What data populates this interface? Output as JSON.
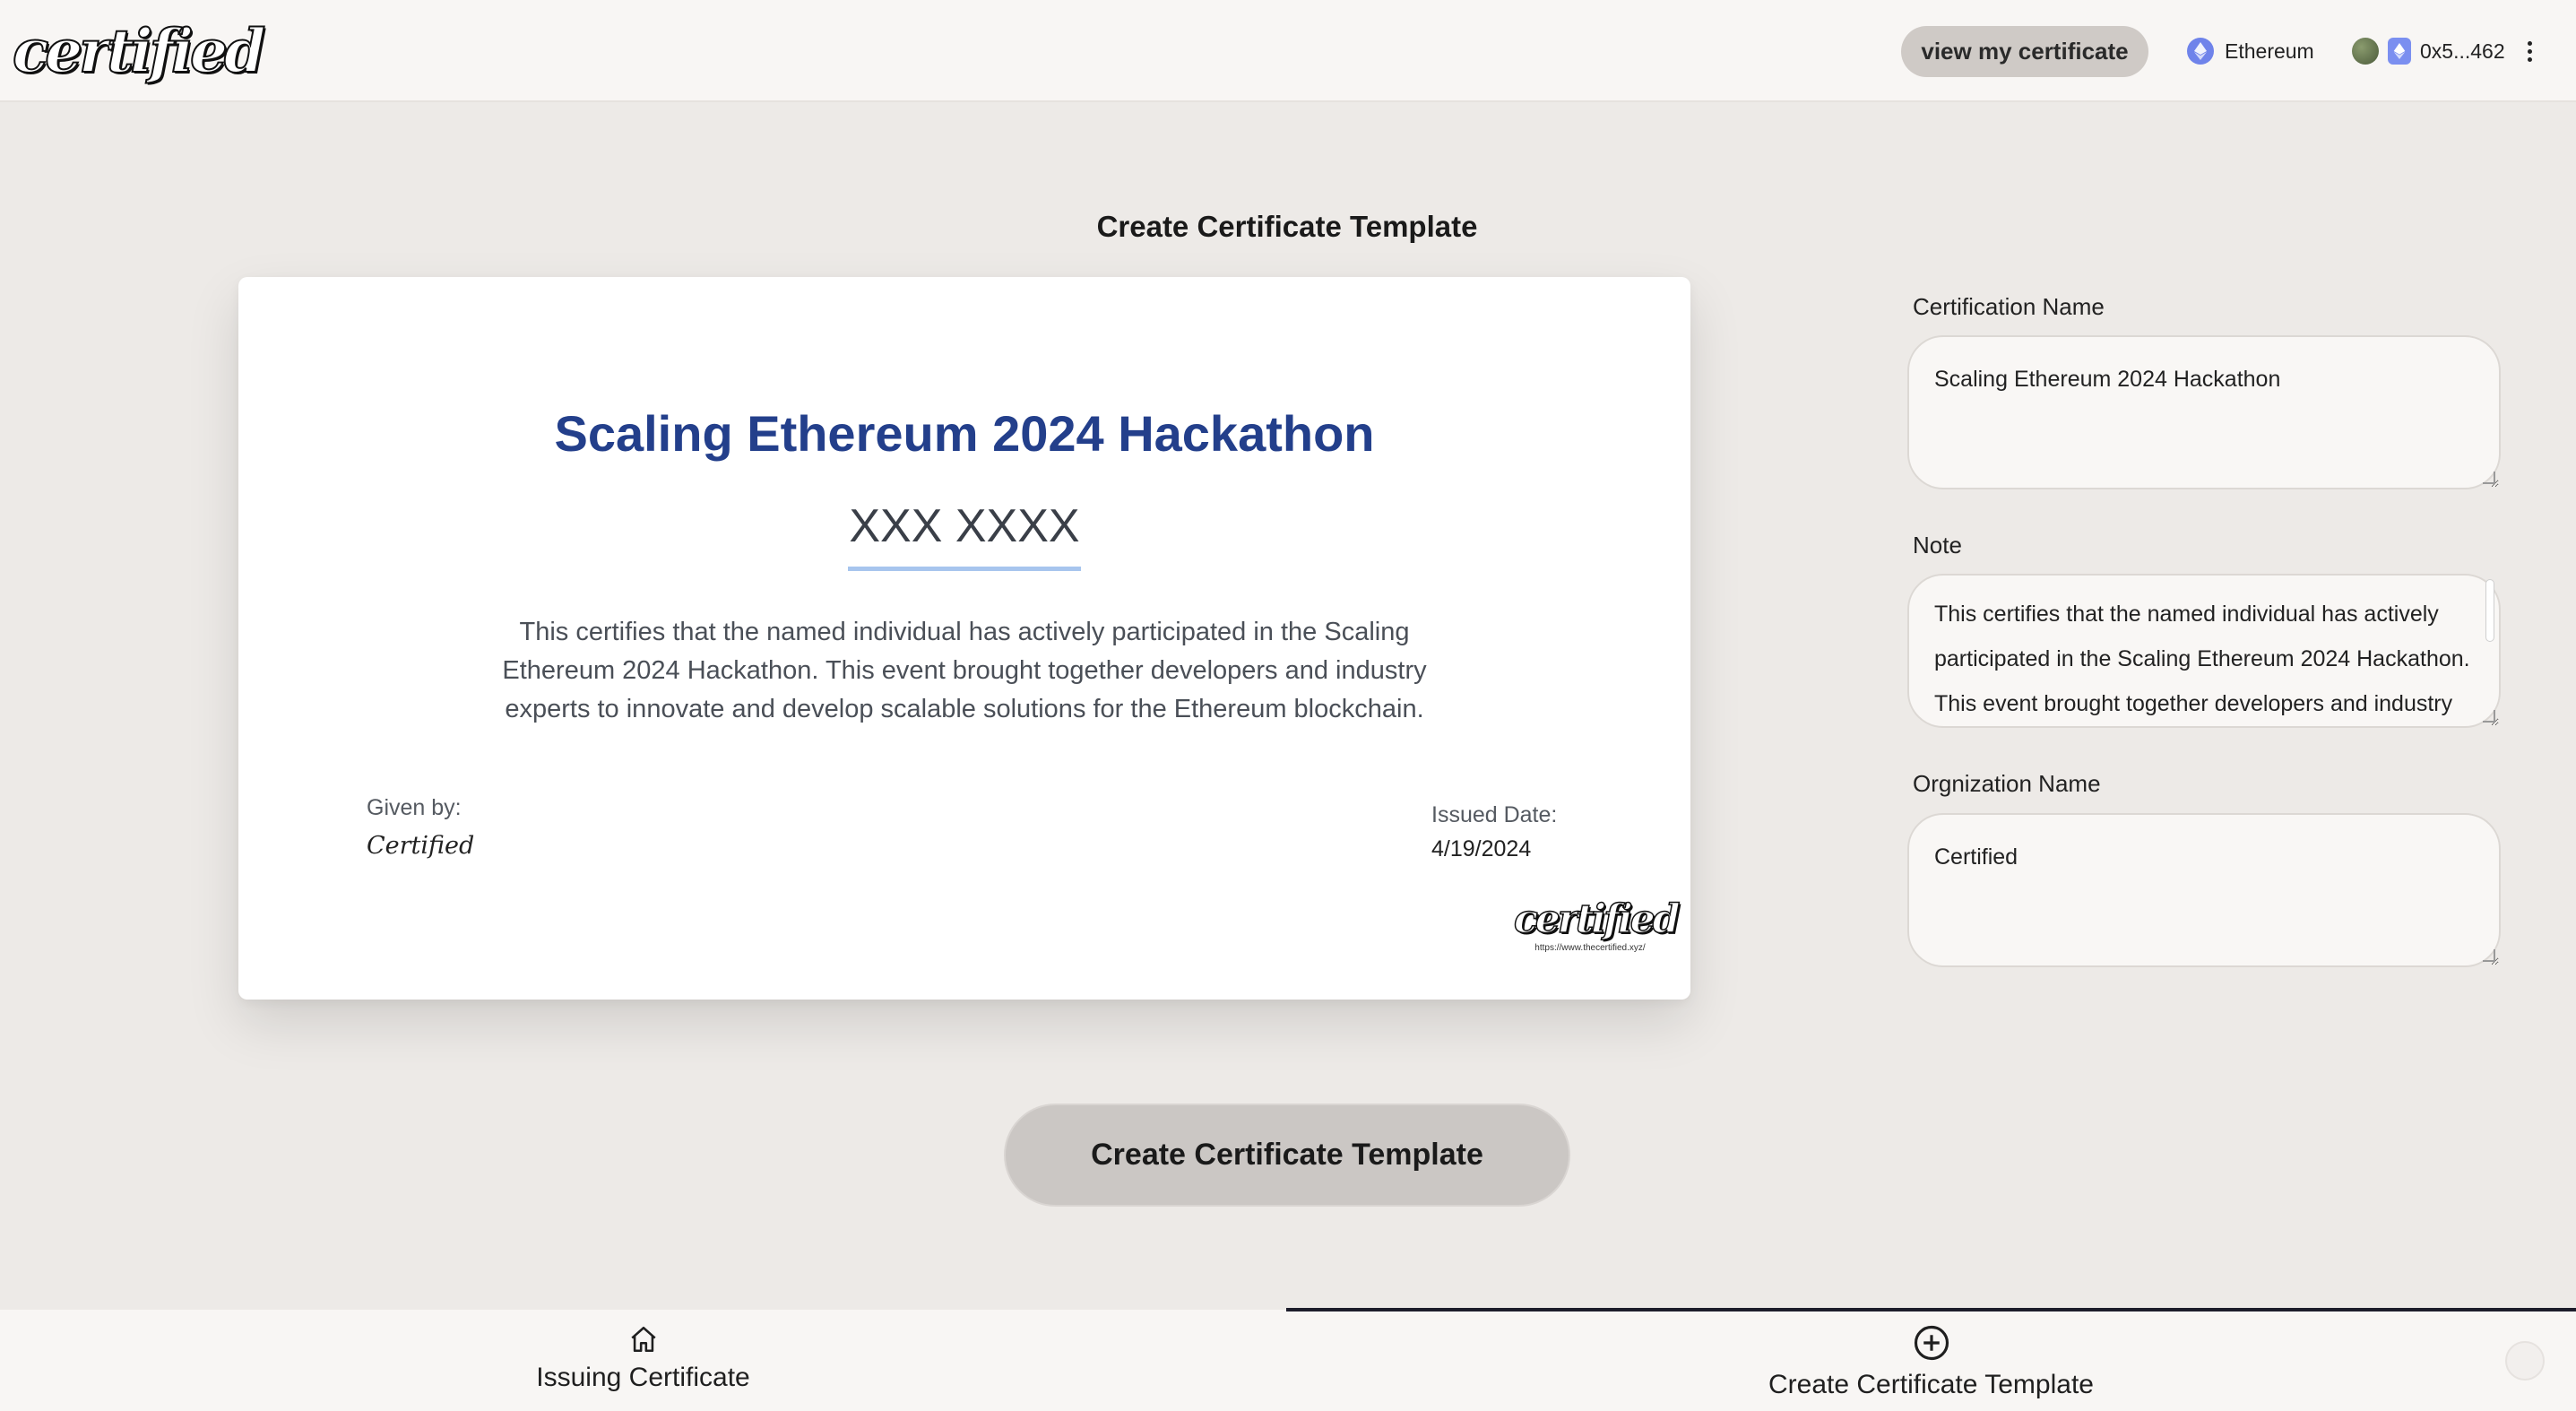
{
  "header": {
    "logo": "certified",
    "view_certificate_label": "view my certificate",
    "network": "Ethereum",
    "account": "0x5...462",
    "network_icon": "ethereum-icon",
    "menu_icon": "kebab-menu-icon"
  },
  "main": {
    "title": "Create Certificate Template",
    "certificate": {
      "name": "Scaling Ethereum 2024 Hackathon",
      "recipient": "XXX XXXX",
      "note": "This certifies that the named individual has actively participated in the Scaling Ethereum 2024 Hackathon. This event brought together developers and industry experts to innovate and develop scalable solutions for the Ethereum blockchain.",
      "given_by_label": "Given by:",
      "given_by": "Certified",
      "issued_date_label": "Issued Date:",
      "issued_date": "4/19/2024",
      "brand": "certified",
      "brand_url": "https://www.thecertified.xyz/"
    },
    "create_button_label": "Create Certificate Template"
  },
  "form": {
    "certification_name_label": "Certification Name",
    "certification_name_value": "Scaling Ethereum 2024 Hackathon",
    "note_label": "Note",
    "note_value": "This certifies that the named individual has actively participated in the Scaling Ethereum 2024 Hackathon. This event brought together developers and industry experts to innovate and develop scalable solutions for the Ethereum blockchain.",
    "organization_label": "Orgnization Name",
    "organization_value": "Certified"
  },
  "bottom_nav": {
    "items": [
      {
        "label": "Issuing Certificate",
        "icon": "home-icon",
        "active": false
      },
      {
        "label": "Create Certificate Template",
        "icon": "plus-circle-icon",
        "active": true
      }
    ]
  },
  "colors": {
    "accent_title": "#233f8b",
    "underline": "#a7c5ee",
    "background": "#edeae7",
    "button": "#cbc7c4"
  }
}
